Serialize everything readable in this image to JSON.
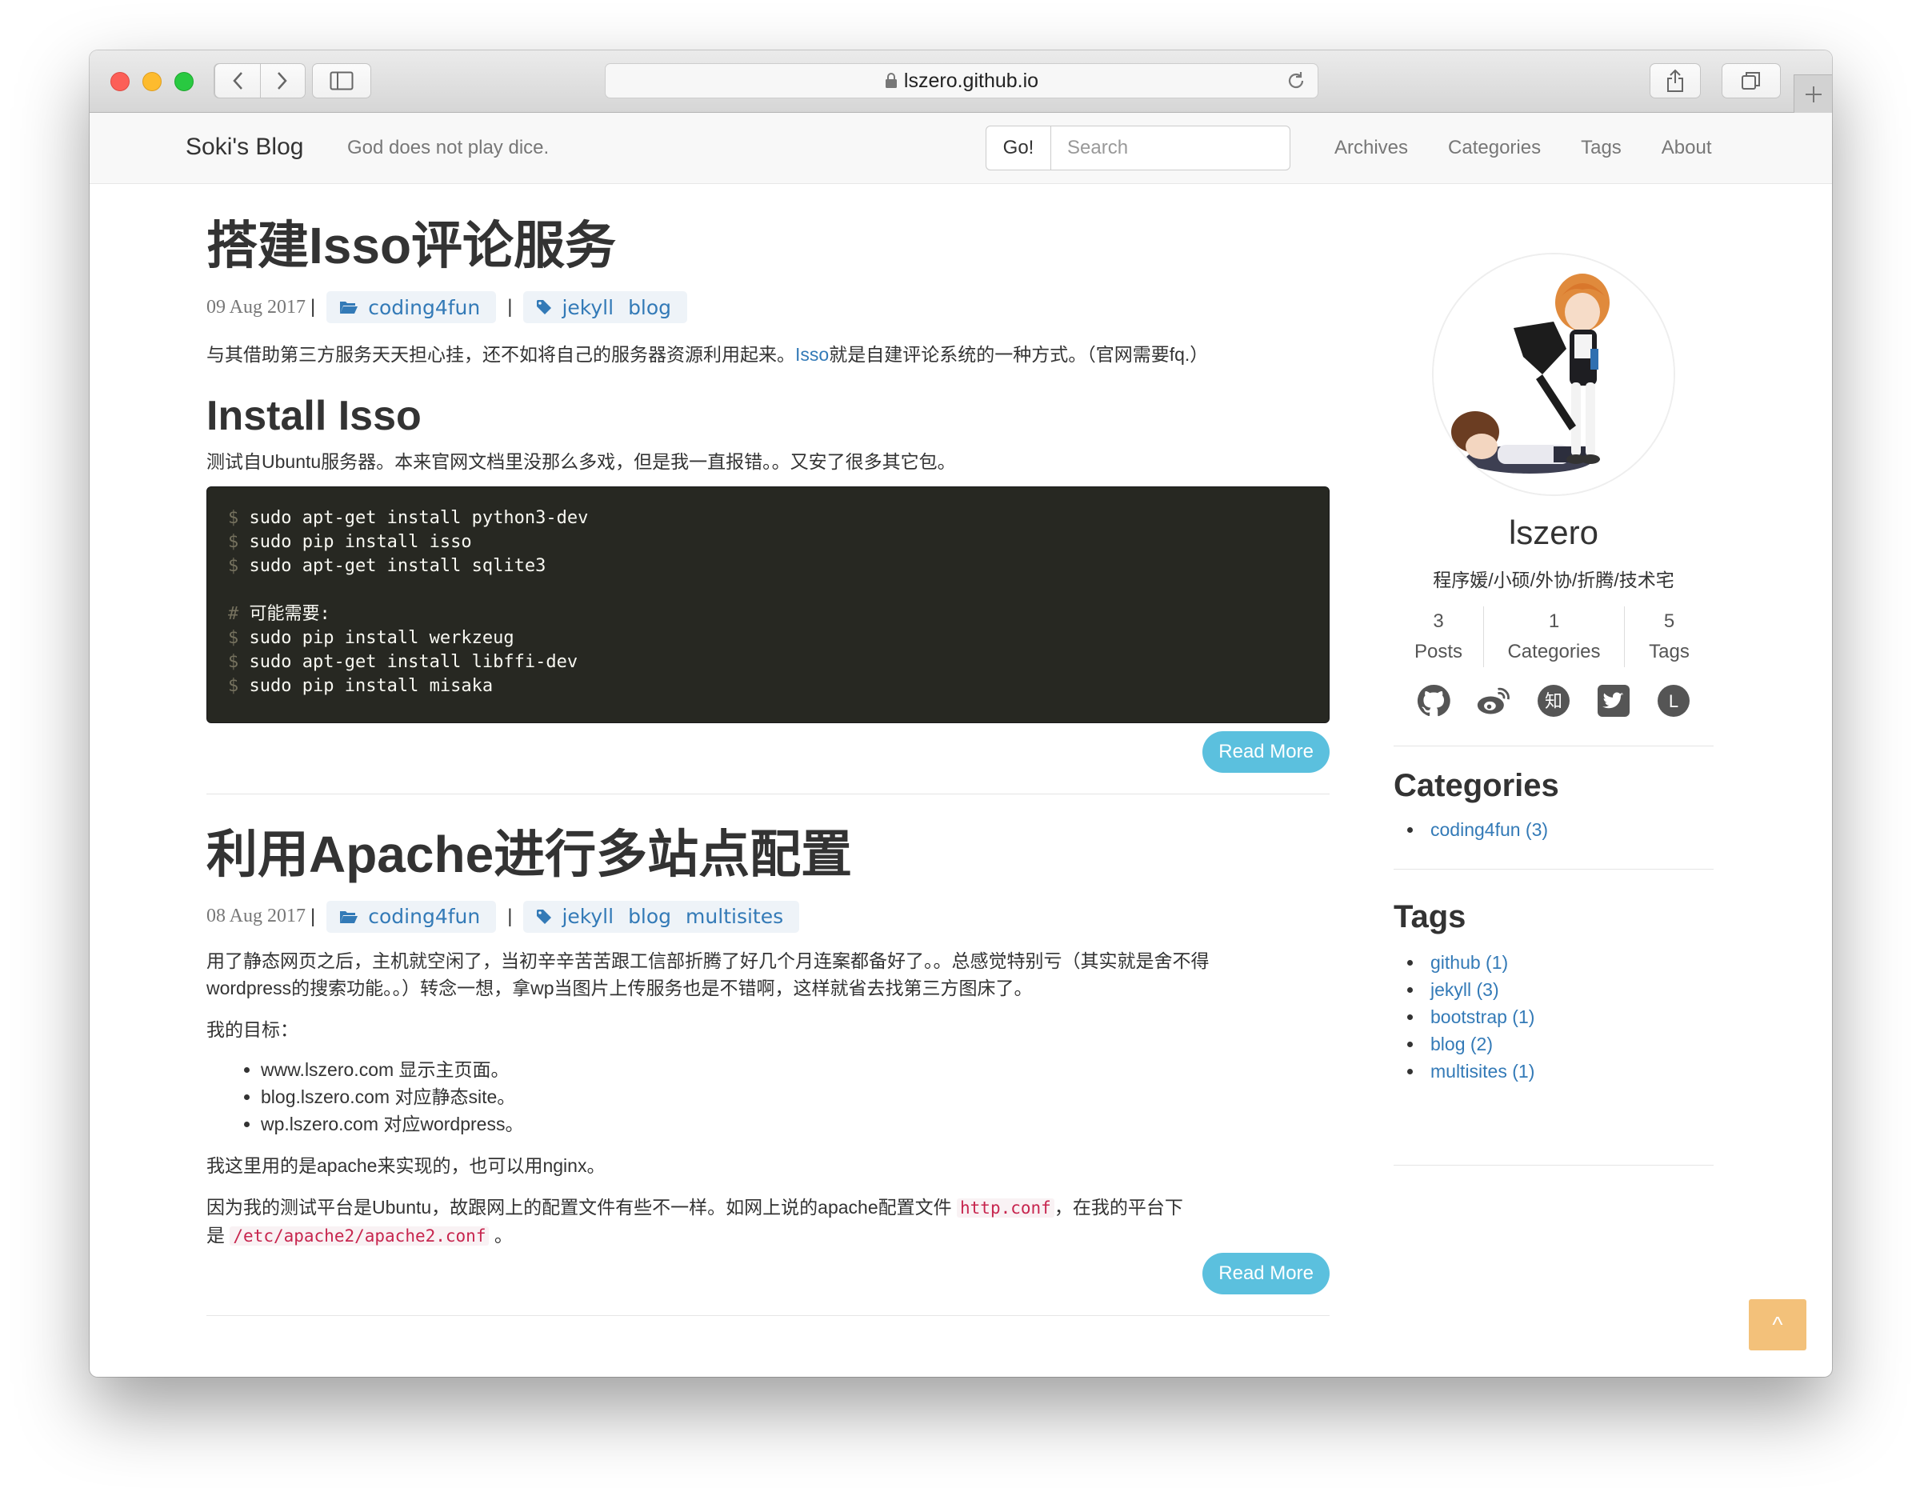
{
  "browser": {
    "url": "lszero.github.io"
  },
  "navbar": {
    "brand": "Soki's Blog",
    "tagline": "God does not play dice.",
    "go_label": "Go!",
    "search_placeholder": "Search",
    "links": [
      "Archives",
      "Categories",
      "Tags",
      "About"
    ]
  },
  "posts": [
    {
      "title": "搭建Isso评论服务",
      "date": "09 Aug 2017",
      "category": "coding4fun",
      "tags": [
        "jekyll",
        "blog"
      ],
      "intro_before": "与其借助第三方服务天天担心挂，还不如将自己的服务器资源利用起来。",
      "intro_link": "Isso",
      "intro_after": "就是自建评论系统的一种方式。（官网需要fq.）",
      "heading": "Install Isso",
      "heading_text": "测试自Ubuntu服务器。本来官网文档里没那么多戏，但是我一直报错。。又安了很多其它包。",
      "code": [
        {
          "p": "$",
          "t": "sudo apt-get install python3-dev"
        },
        {
          "p": "$",
          "t": "sudo pip install isso"
        },
        {
          "p": "$",
          "t": "sudo apt-get install sqlite3"
        },
        {
          "p": "",
          "t": ""
        },
        {
          "p": "#",
          "t": "可能需要:"
        },
        {
          "p": "$",
          "t": "sudo pip install werkzeug"
        },
        {
          "p": "$",
          "t": "sudo apt-get install libffi-dev"
        },
        {
          "p": "$",
          "t": "sudo pip install misaka"
        }
      ],
      "read_more": "Read More"
    },
    {
      "title": "利用Apache进行多站点配置",
      "date": "08 Aug 2017",
      "category": "coding4fun",
      "tags": [
        "jekyll",
        "blog",
        "multisites"
      ],
      "para1_line1": "用了静态网页之后，主机就空闲了，当初辛辛苦苦跟工信部折腾了好几个月连案都备好了。。总感觉特别亏（其实就是舍不得",
      "para1_line2": "wordpress的搜索功能。。）转念一想，拿wp当图片上传服务也是不错啊，这样就省去找第三方图床了。",
      "goals_label": "我的目标：",
      "goals": [
        "www.lszero.com 显示主页面。",
        "blog.lszero.com 对应静态site。",
        "wp.lszero.com 对应wordpress。"
      ],
      "para3": "我这里用的是apache来实现的，也可以用nginx。",
      "para4_a": "因为我的测试平台是Ubuntu，故跟网上的配置文件有些不一样。如网上说的apache配置文件 ",
      "para4_code1": "http.conf",
      "para4_b": "，在我的平台下",
      "para4_c": "是 ",
      "para4_code2": "/etc/apache2/apache2.conf",
      "para4_d": " 。",
      "read_more": "Read More"
    }
  ],
  "sidebar": {
    "name": "lszero",
    "bio": "程序媛/小硕/外协/折腾/技术宅",
    "stats": [
      {
        "count": "3",
        "label": "Posts"
      },
      {
        "count": "1",
        "label": "Categories"
      },
      {
        "count": "5",
        "label": "Tags"
      }
    ],
    "social_icons": [
      "github-icon",
      "weibo-icon",
      "zhihu-icon",
      "twitter-icon",
      "linkedin-icon"
    ],
    "zhihu_glyph": "知",
    "l_glyph": "L",
    "categories_title": "Categories",
    "categories": [
      "coding4fun (3)"
    ],
    "tags_title": "Tags",
    "tags": [
      "github (1)",
      "jekyll (3)",
      "bootstrap (1)",
      "blog (2)",
      "multisites (1)"
    ]
  },
  "back_to_top": "^",
  "colors": {
    "accent": "#337ab7",
    "read_more": "#5bc0de",
    "back_to_top": "#f0ad4e",
    "code_bg": "#272822"
  }
}
